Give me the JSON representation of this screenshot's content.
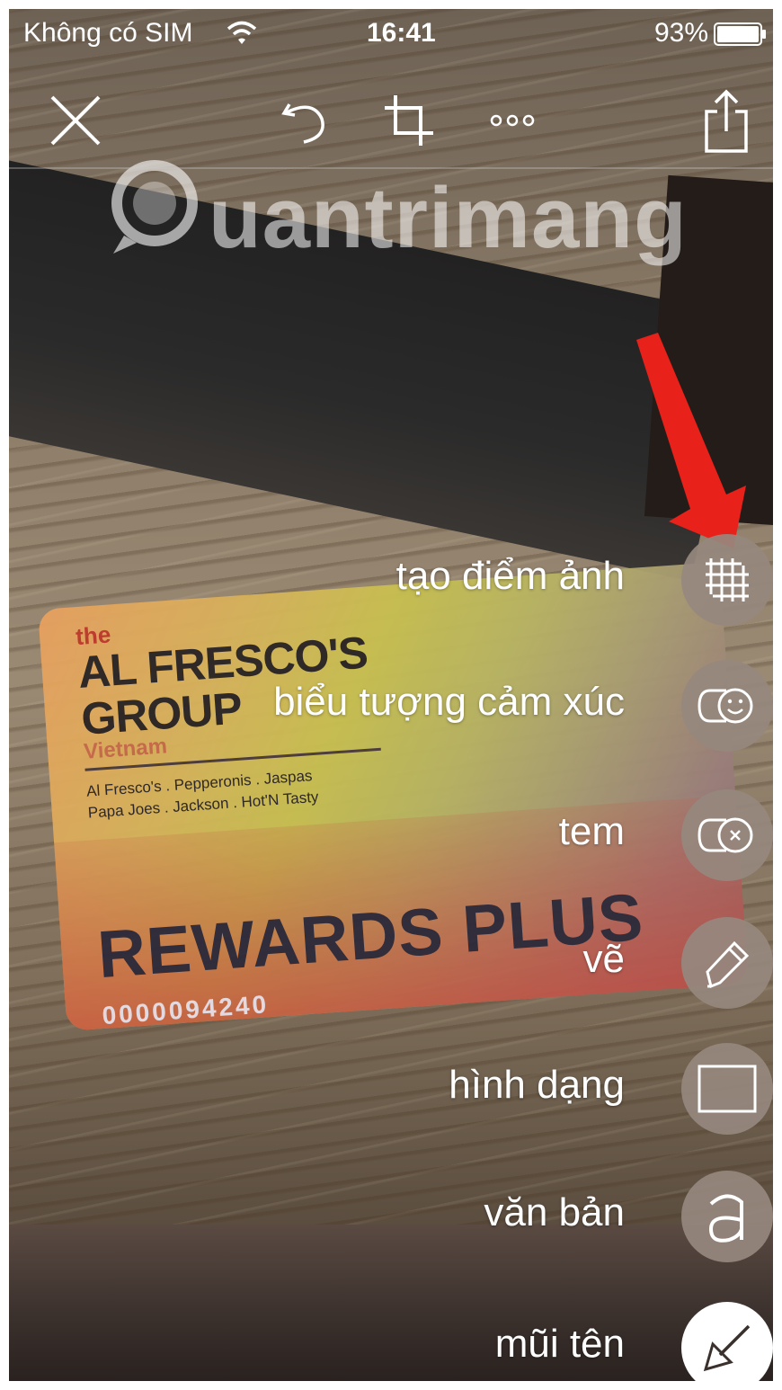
{
  "status_bar": {
    "carrier": "Không có SIM",
    "time": "16:41",
    "battery_percent": "93%",
    "wifi_icon": "wifi-icon",
    "battery_icon": "battery-icon"
  },
  "toolbar": {
    "close_icon": "close-icon",
    "undo_icon": "undo-icon",
    "crop_icon": "crop-icon",
    "more_icon": "more-icon",
    "share_icon": "share-icon"
  },
  "watermark": {
    "text": "uantrimang"
  },
  "photo": {
    "card": {
      "the": "the",
      "brand_line1": "AL FRESCO'S",
      "brand_line2": "GROUP",
      "country": "Vietnam",
      "brands_line1": "Al Fresco's . Pepperonis . Jaspas",
      "brands_line2": "Papa Joes . Jackson . Hot'N Tasty",
      "rewards": "REWARDS PLUS",
      "number": "0000094240"
    }
  },
  "menu": {
    "items": [
      {
        "label": "tạo điểm ảnh",
        "icon": "pixelate-grid-icon"
      },
      {
        "label": "biểu tượng cảm xúc",
        "icon": "emoji-icon"
      },
      {
        "label": "tem",
        "icon": "stamp-icon"
      },
      {
        "label": "vẽ",
        "icon": "pencil-icon"
      },
      {
        "label": "hình dạng",
        "icon": "rectangle-shape-icon"
      },
      {
        "label": "văn bản",
        "icon": "text-a-icon"
      },
      {
        "label": "mũi tên",
        "icon": "arrow-icon"
      }
    ]
  },
  "colors": {
    "annotation_arrow": "#e8211a",
    "menu_circle": "#968878",
    "active_circle": "#ffffff"
  }
}
